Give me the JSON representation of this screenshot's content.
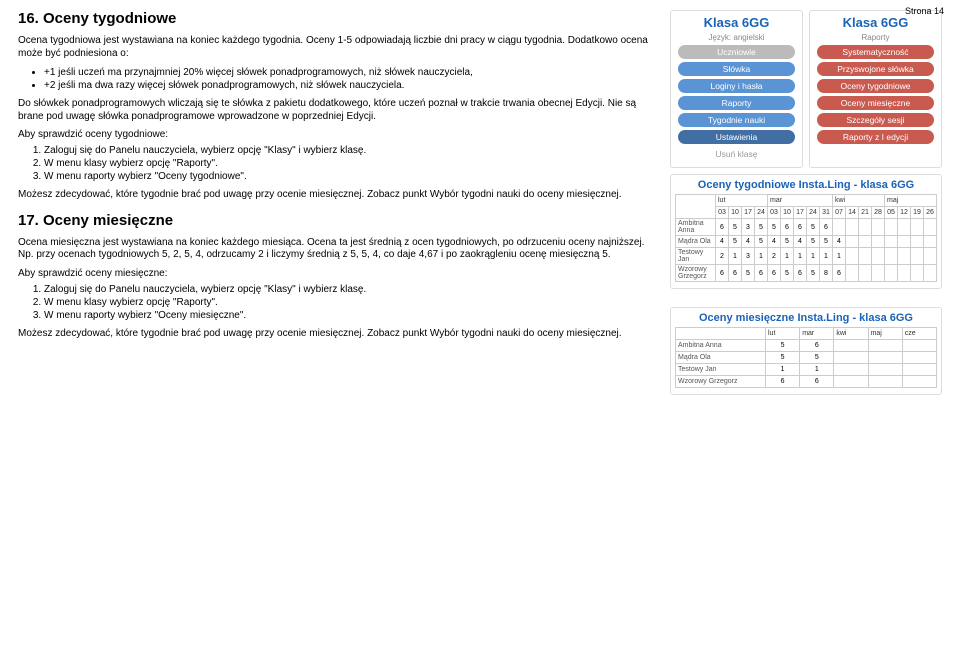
{
  "page_label": "Strona 14",
  "section16": {
    "title": "16. Oceny tygodniowe",
    "p1": "Ocena tygodniowa jest wystawiana na koniec każdego tygodnia. Oceny 1-5 odpowiadają liczbie dni pracy w ciągu tygodnia. Dodatkowo ocena może być podniesiona o:",
    "bullets": [
      "+1 jeśli uczeń ma przynajmniej 20% więcej słówek ponadprogramowych, niż słówek nauczyciela,",
      "+2 jeśli ma dwa razy więcej słówek ponadprogramowych, niż słówek nauczyciela."
    ],
    "p2": "Do słówkek ponadprogramowych wliczają się te słówka z pakietu dodatkowego, które uczeń poznał w trakcie trwania obecnej Edycji. Nie są brane pod uwagę słówka ponadprogramowe wprowadzone w poprzedniej Edycji.",
    "p3": "Aby sprawdzić oceny tygodniowe:",
    "steps": [
      "Zaloguj się do Panelu nauczyciela, wybierz opcję \"Klasy\" i wybierz klasę.",
      "W menu klasy wybierz opcję \"Raporty\".",
      "W menu raporty wybierz \"Oceny tygodniowe\"."
    ],
    "p4": "Możesz zdecydować, które tygodnie brać pod uwagę przy ocenie miesięcznej. Zobacz punkt Wybór tygodni nauki do oceny miesięcznej."
  },
  "section17": {
    "title": "17. Oceny miesięczne",
    "p1": "Ocena miesięczna jest wystawiana na koniec każdego miesiąca. Ocena ta jest średnią z ocen tygodniowych, po odrzuceniu oceny najniższej. Np. przy ocenach tygodniowych 5, 2, 5, 4, odrzucamy 2 i liczymy średnią z 5, 5, 4, co daje 4,67 i po zaokrągleniu ocenę miesięczną 5.",
    "p2": "Aby sprawdzić oceny miesięczne:",
    "steps": [
      "Zaloguj się do Panelu nauczyciela, wybierz opcję \"Klasy\" i wybierz klasę.",
      "W menu klasy wybierz opcję \"Raporty\".",
      "W menu raporty wybierz \"Oceny miesięczne\"."
    ],
    "p3": "Możesz zdecydować, które tygodnie brać pod uwagę przy ocenie miesięcznej. Zobacz punkt Wybór tygodni nauki do oceny miesięcznej."
  },
  "cards": {
    "left": {
      "title": "Klasa 6GG",
      "sub": "Język: angielski",
      "items": [
        "Uczniowie",
        "Słówka",
        "Loginy i hasła",
        "Raporty",
        "Tygodnie nauki",
        "Ustawienia",
        "Usuń klasę"
      ]
    },
    "right": {
      "title": "Klasa 6GG",
      "sub": "Raporty",
      "items": [
        "Systematyczność",
        "Przyswojone słówka",
        "Oceny tygodniowe",
        "Oceny miesięczne",
        "Szczegóły sesji",
        "Raporty z I edycji"
      ]
    }
  },
  "weekly": {
    "title": "Oceny tygodniowe Insta.Ling - klasa 6GG",
    "months": [
      "lut",
      "mar",
      "kwi",
      "maj"
    ],
    "days": [
      "03",
      "10",
      "17",
      "24",
      "03",
      "10",
      "17",
      "24",
      "31",
      "07",
      "14",
      "21",
      "28",
      "05",
      "12",
      "19",
      "26"
    ],
    "rows": [
      {
        "name": "Ambitna Anna",
        "vals": [
          "6",
          "5",
          "3",
          "5",
          "5",
          "6",
          "6",
          "5",
          "6",
          "",
          "",
          "",
          "",
          "",
          "",
          "",
          ""
        ]
      },
      {
        "name": "Mądra Ola",
        "vals": [
          "4",
          "5",
          "4",
          "5",
          "4",
          "5",
          "4",
          "5",
          "5",
          "4",
          "",
          "",
          "",
          "",
          "",
          "",
          ""
        ]
      },
      {
        "name": "Testowy Jan",
        "vals": [
          "2",
          "1",
          "3",
          "1",
          "2",
          "1",
          "1",
          "1",
          "1",
          "1",
          "",
          "",
          "",
          "",
          "",
          "",
          ""
        ]
      },
      {
        "name": "Wzorowy Grzegorz",
        "vals": [
          "6",
          "6",
          "5",
          "6",
          "6",
          "5",
          "6",
          "5",
          "8",
          "6",
          "",
          "",
          "",
          "",
          "",
          "",
          ""
        ]
      }
    ]
  },
  "monthly": {
    "title": "Oceny miesięczne Insta.Ling - klasa 6GG",
    "months": [
      "lut",
      "mar",
      "kwi",
      "maj",
      "cze"
    ],
    "rows": [
      {
        "name": "Ambitna Anna",
        "vals": [
          "5",
          "6",
          "",
          "",
          ""
        ]
      },
      {
        "name": "Mądra Ola",
        "vals": [
          "5",
          "5",
          "",
          "",
          ""
        ]
      },
      {
        "name": "Testowy Jan",
        "vals": [
          "1",
          "1",
          "",
          "",
          ""
        ]
      },
      {
        "name": "Wzorowy Grzegorz",
        "vals": [
          "6",
          "6",
          "",
          "",
          ""
        ]
      }
    ]
  }
}
